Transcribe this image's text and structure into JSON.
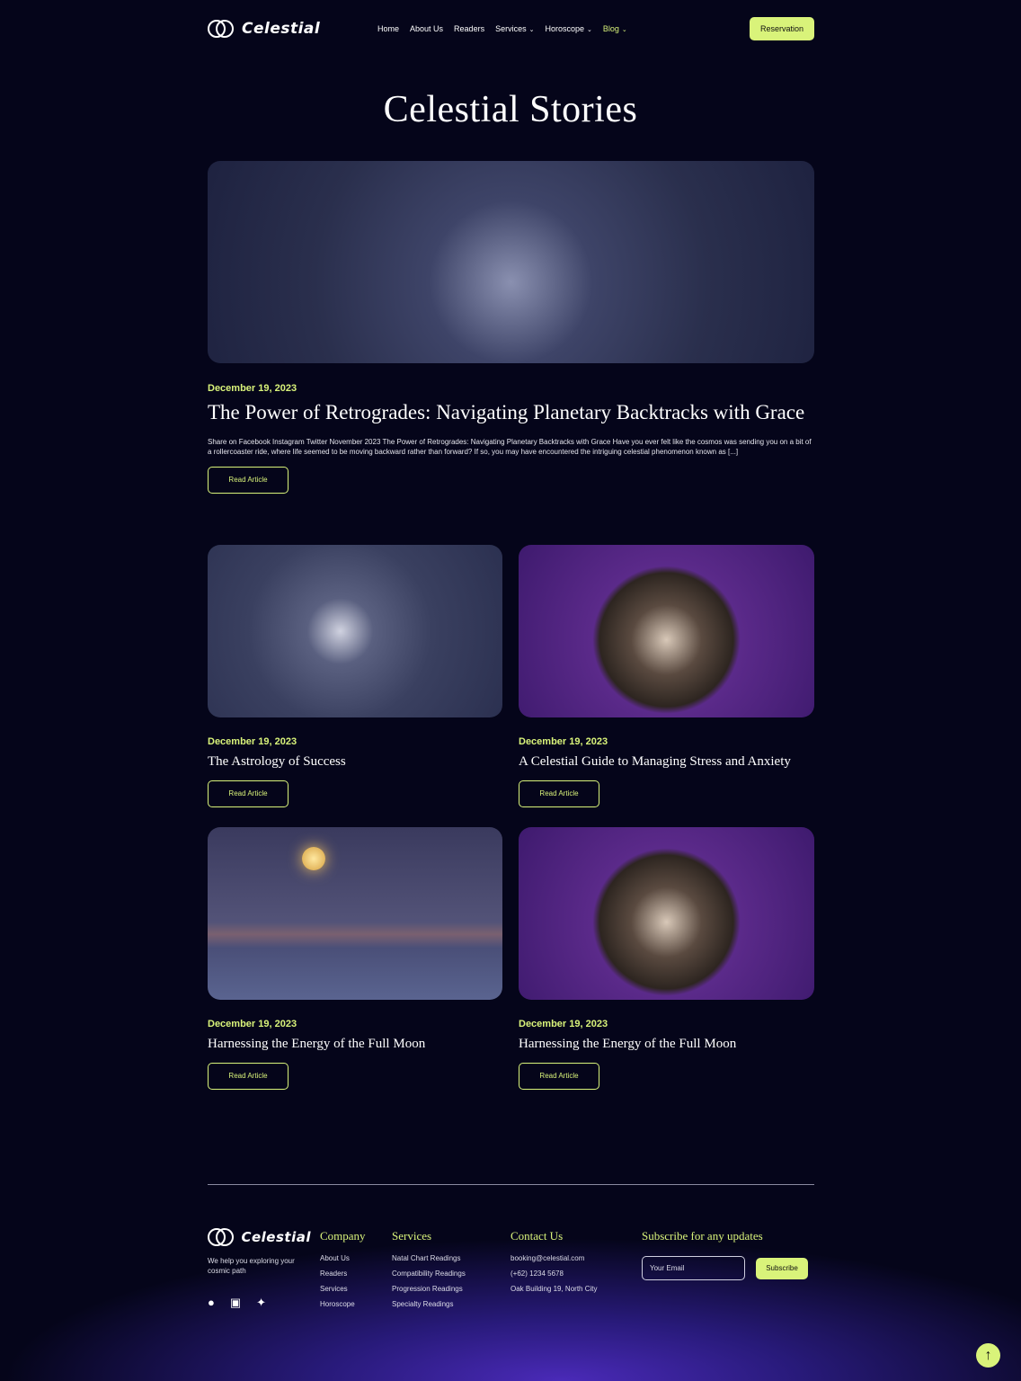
{
  "header": {
    "logo": "Celestial",
    "nav": [
      {
        "label": "Home"
      },
      {
        "label": "About Us"
      },
      {
        "label": "Readers"
      },
      {
        "label": "Services",
        "dropdown": true
      },
      {
        "label": "Horoscope",
        "dropdown": true
      },
      {
        "label": "Blog",
        "dropdown": true,
        "active": true
      }
    ],
    "cta": "Reservation"
  },
  "page": {
    "title": "Celestial Stories"
  },
  "featured": {
    "date": "December 19, 2023",
    "title": "The Power of Retrogrades: Navigating Planetary Backtracks with Grace",
    "excerpt": "Share on Facebook Instagram Twitter November 2023 The Power of Retrogrades: Navigating Planetary Backtracks with Grace Have you ever felt like the cosmos was sending you on a bit of a rollercoaster ride, where life seemed to be moving backward rather than forward? If so, you may have encountered the intriguing celestial phenomenon known as [...]",
    "button": "Read Article"
  },
  "posts": [
    {
      "date": "December 19, 2023",
      "title": "The Astrology of Success",
      "button": "Read Article"
    },
    {
      "date": "December 19, 2023",
      "title": "A Celestial Guide to Managing Stress and Anxiety",
      "button": "Read Article"
    },
    {
      "date": "December 19, 2023",
      "title": "Harnessing the Energy of the Full Moon",
      "button": "Read Article"
    },
    {
      "date": "December 19, 2023",
      "title": "Harnessing the Energy of the Full Moon",
      "button": "Read Article"
    }
  ],
  "footer": {
    "logo": "Celestial",
    "tagline": "We help you exploring your cosmic path",
    "company": {
      "heading": "Company",
      "links": [
        "About Us",
        "Readers",
        "Services",
        "Horoscope"
      ]
    },
    "services": {
      "heading": "Services",
      "links": [
        "Natal Chart Readings",
        "Compatibility Readings",
        "Progression Readings",
        "Specialty Readings"
      ]
    },
    "contact": {
      "heading": "Contact Us",
      "email": "booking@celestial.com",
      "phone": "(+62) 1234 5678",
      "address": "Oak Building 19, North City"
    },
    "subscribe": {
      "heading": "Subscribe for any updates",
      "placeholder": "Your Email",
      "button": "Subscribe"
    },
    "social": [
      "facebook",
      "instagram",
      "twitter"
    ]
  },
  "colors": {
    "accent": "#d9f37a",
    "background": "#05051a"
  }
}
